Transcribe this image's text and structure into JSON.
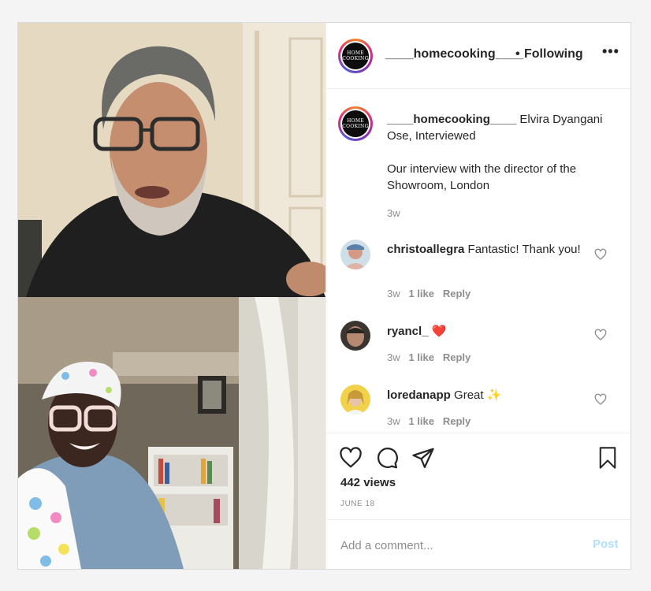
{
  "post": {
    "header": {
      "avatar_text": [
        "HOME",
        "COOKING"
      ],
      "username": "____homecooking____",
      "separator": "•",
      "follow_status": "Following",
      "more": "•••"
    },
    "caption": {
      "username": "____homecooking____",
      "text": " Elvira Dyangani Ose, Interviewed",
      "body": "Our interview with the director of the Showroom, London",
      "time": "3w"
    },
    "comments": [
      {
        "username": "christoallegra",
        "text": " Fantastic! Thank you!",
        "time": "3w",
        "likes": "1 like",
        "reply": "Reply"
      },
      {
        "username": "ryancl_",
        "text": " ❤️",
        "time": "3w",
        "likes": "1 like",
        "reply": "Reply"
      },
      {
        "username": "loredanapp",
        "text": " Great ✨",
        "time": "3w",
        "likes": "1 like",
        "reply": "Reply"
      }
    ],
    "views": "442 views",
    "date": "JUNE 18",
    "add_comment_placeholder": "Add a comment...",
    "post_button": "Post"
  },
  "icons": {
    "like": "heart-icon",
    "comment": "comment-icon",
    "share": "paper-plane-icon",
    "save": "bookmark-icon",
    "comment_like": "heart-icon"
  },
  "colors": {
    "text": "#262626",
    "secondary": "#8e8e8e",
    "post_button_disabled": "#b2dffc",
    "border": "#dbdbdb"
  }
}
